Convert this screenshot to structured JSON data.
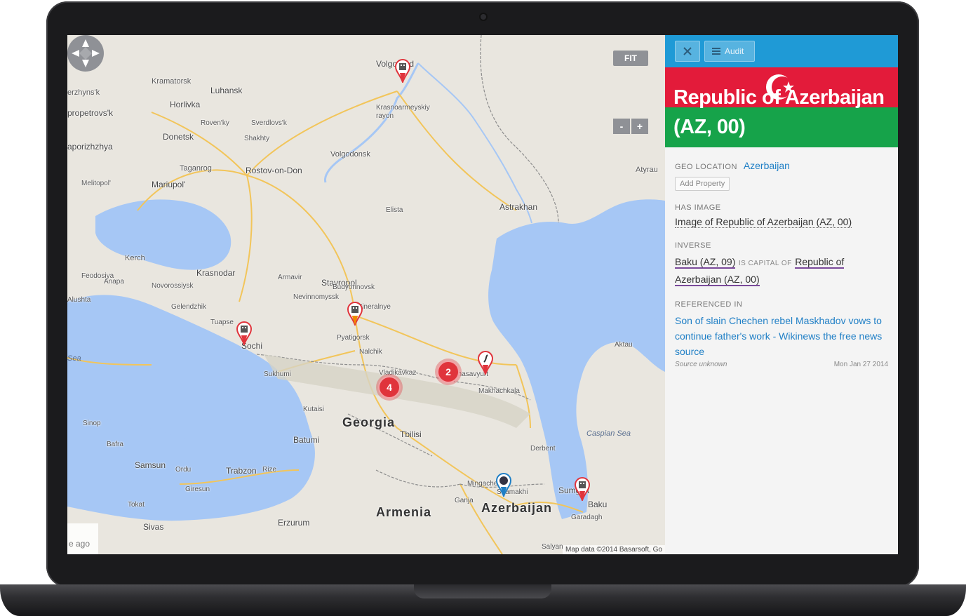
{
  "map": {
    "labels": {
      "volgograd": "Volgograd",
      "krasnoarmeysky": "Krasnoarmeyskiy rayon",
      "kramatorsk": "Kramatorsk",
      "luhansk": "Luhansk",
      "horlivka": "Horlivka",
      "rovenky": "Roven'ky",
      "sverdlovsk": "Sverdlovs'k",
      "shakhty": "Shakhty",
      "donetsk": "Donetsk",
      "volgodonsk": "Volgodonsk",
      "zerzhynsk": "erzhyns'k",
      "dnipropetrovsk": "propetrovs'k",
      "zaporizhzhya": "aporizhzhya",
      "taganrog": "Taganrog",
      "rostov": "Rostov-on-Don",
      "melitopol": "Melitopol'",
      "mariupol": "Mariupol'",
      "atyrau": "Atyrau",
      "elista": "Elista",
      "astrakhan": "Astrakhan",
      "kerch": "Kerch",
      "krasnodar": "Krasnodar",
      "feodosiya": "Feodosiya",
      "anapa": "Anapa",
      "armavir": "Armavir",
      "stavropol": "Stavropol",
      "nevinnomyssk": "Nevinnomyssk",
      "budyonnovsk": "Budyonnovsk",
      "novorossiysk": "Novorossiysk",
      "alushta": "Alushta",
      "gelendzhik": "Gelendzhik",
      "tuapse": "Tuapse",
      "sochi": "Sochi",
      "pyatigorsk": "Pyatigorsk",
      "mineralnye": "Mineralnye",
      "nalchik": "Nalchik",
      "vladikavkaz": "Vladikavkaz",
      "khasavyurt": "Khasavyurt",
      "makhachkala": "Makhachkala",
      "sukhumi": "Sukhumi",
      "kutaisi": "Kutaisi",
      "georgia": "Georgia",
      "tbilisi": "Tbilisi",
      "derbent": "Derbent",
      "caspian": "Caspian Sea",
      "aktau": "Aktau",
      "sea_left": "Sea",
      "sinop": "Sinop",
      "bafra": "Bafra",
      "samsun": "Samsun",
      "ordu": "Ordu",
      "trabzon": "Trabzon",
      "rize": "Rize",
      "batumi": "Batumi",
      "giresun": "Giresun",
      "tokat": "Tokat",
      "sivas": "Sivas",
      "erzurum": "Erzurum",
      "armenia": "Armenia",
      "mingachevir": "Mingachevir",
      "shamakhi": "Shamakhi",
      "ganja": "Ganja",
      "azerbaijan": "Azerbaijan",
      "sumgait": "Sumgait",
      "baku": "Baku",
      "garadagh": "Garadagh",
      "salyan": "Salyan",
      "ago": "e ago"
    },
    "controls": {
      "fit_label": "FIT",
      "zoom_out": "-",
      "zoom_in": "+"
    },
    "clusters": {
      "c1": "4",
      "c2": "2"
    },
    "attribution": "Map data ©2014 Basarsoft, Go",
    "colors": {
      "land": "#e9e6df",
      "water": "#a6c7f5",
      "road": "#f2c55a",
      "pin_red": "#e0343c",
      "pin_blue": "#1f7fc6"
    }
  },
  "panel": {
    "toolbar": {
      "close_icon": "close-icon",
      "audit_label": "Audit"
    },
    "title_line1": "Republic of Azerbaijan",
    "title_line2": "(AZ, 00)",
    "flag_colors": {
      "red": "#e31b3a",
      "green": "#16a34a",
      "blue": "#1f9ad6"
    },
    "geo_location": {
      "key": "GEO LOCATION",
      "value": "Azerbaijan",
      "add_property": "Add Property"
    },
    "has_image": {
      "key": "HAS IMAGE",
      "value": "Image of Republic of Azerbaijan (AZ, 00)"
    },
    "inverse": {
      "key": "INVERSE",
      "subject": "Baku (AZ, 09)",
      "predicate": "IS CAPITAL OF",
      "object": "Republic of Azerbaijan (AZ, 00)"
    },
    "referenced_in": {
      "key": "REFERENCED IN",
      "title": "Son of slain Chechen rebel Maskhadov vows to continue father's work - Wikinews the free news source",
      "source": "Source unknown",
      "date": "Mon Jan 27 2014"
    }
  }
}
